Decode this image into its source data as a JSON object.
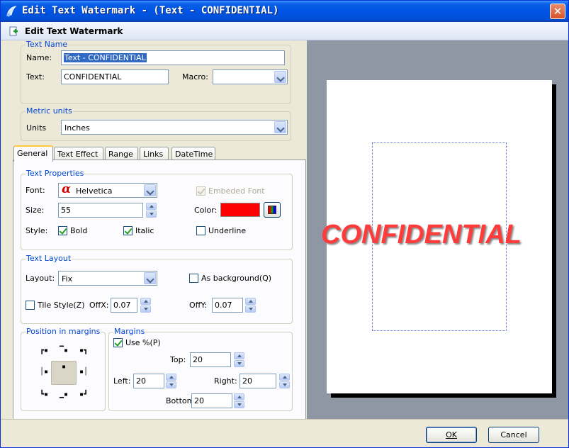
{
  "window": {
    "title": "Edit Text Watermark - (Text - CONFIDENTIAL)"
  },
  "header": {
    "title": "Edit Text Watermark"
  },
  "text_name": {
    "legend": "Text Name",
    "name_label": "Name:",
    "name_value": "Text - CONFIDENTIAL",
    "text_label": "Text:",
    "text_value": "CONFIDENTIAL",
    "macro_label": "Macro:",
    "macro_value": ""
  },
  "metric": {
    "legend": "Metric units",
    "units_label": "Units",
    "units_value": "Inches"
  },
  "tabs": [
    {
      "label": "General",
      "active": true
    },
    {
      "label": "Text Effect"
    },
    {
      "label": "Range"
    },
    {
      "label": "Links"
    },
    {
      "label": "DateTime"
    }
  ],
  "text_properties": {
    "legend": "Text Properties",
    "font_label": "Font:",
    "font_value": "Helvetica",
    "embedded_font_label": "Embeded Font",
    "embedded_font_checked": true,
    "size_label": "Size:",
    "size_value": "55",
    "color_label": "Color:",
    "color_value": "#ff0000",
    "style_label": "Style:",
    "bold_label": "Bold",
    "bold_checked": true,
    "italic_label": "Italic",
    "italic_checked": true,
    "underline_label": "Underline",
    "underline_checked": false
  },
  "text_layout": {
    "legend": "Text Layout",
    "layout_label": "Layout:",
    "layout_value": "Fix",
    "as_background_label": "As background(Q)",
    "as_background_checked": false,
    "tile_style_label": "Tile Style(Z)",
    "tile_style_checked": false,
    "offx_label": "OffX:",
    "offx_value": "0.07",
    "offy_label": "OffY:",
    "offy_value": "0.07"
  },
  "position": {
    "legend": "Position in margins"
  },
  "margins": {
    "legend": "Margins",
    "use_percent_label": "Use %(P)",
    "use_percent_checked": true,
    "top_label": "Top:",
    "top_value": "20",
    "left_label": "Left:",
    "left_value": "20",
    "right_label": "Right:",
    "right_value": "20",
    "bottom_label": "Bottom:",
    "bottom_value": "20"
  },
  "preview": {
    "watermark_text": "CONFIDENTIAL",
    "watermark_color": "#ff3b3b"
  },
  "footer": {
    "ok_label": "OK",
    "cancel_label": "Cancel"
  }
}
